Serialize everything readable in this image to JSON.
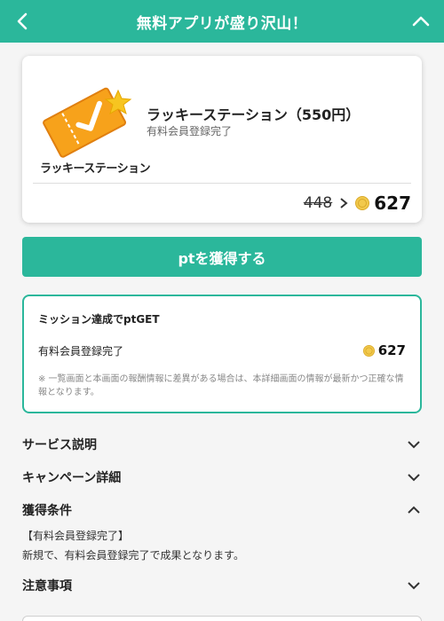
{
  "header": {
    "title": "無料アプリが盛り沢山！",
    "back_icon": "chevron-left-icon",
    "collapse_icon": "chevron-up-icon"
  },
  "offer": {
    "logo_text": "ラッキーステーション",
    "name": "ラッキーステーション（550円）",
    "condition": "有料会員登録完了",
    "old_points": "448",
    "new_points": "627"
  },
  "get_button_label": "ptを獲得する",
  "mission": {
    "title": "ミッション達成でptGET",
    "item_label": "有料会員登録完了",
    "item_points": "627",
    "note": "※ 一覧画面と本画面の報酬情報に差異がある場合は、本詳細画面の情報が最新かつ正確な情報となります。"
  },
  "accordion": {
    "service": "サービス説明",
    "campaign": "キャンペーン詳細",
    "conditions": "獲得条件",
    "conditions_line1": "【有料会員登録完了】",
    "conditions_line2": "新規で、有料会員登録完了で成果となります。",
    "notes": "注意事項"
  },
  "colors": {
    "accent": "#2bb79b",
    "coin": "#f2c94c",
    "logo_orange": "#f7a21b",
    "star": "#f7c520"
  }
}
